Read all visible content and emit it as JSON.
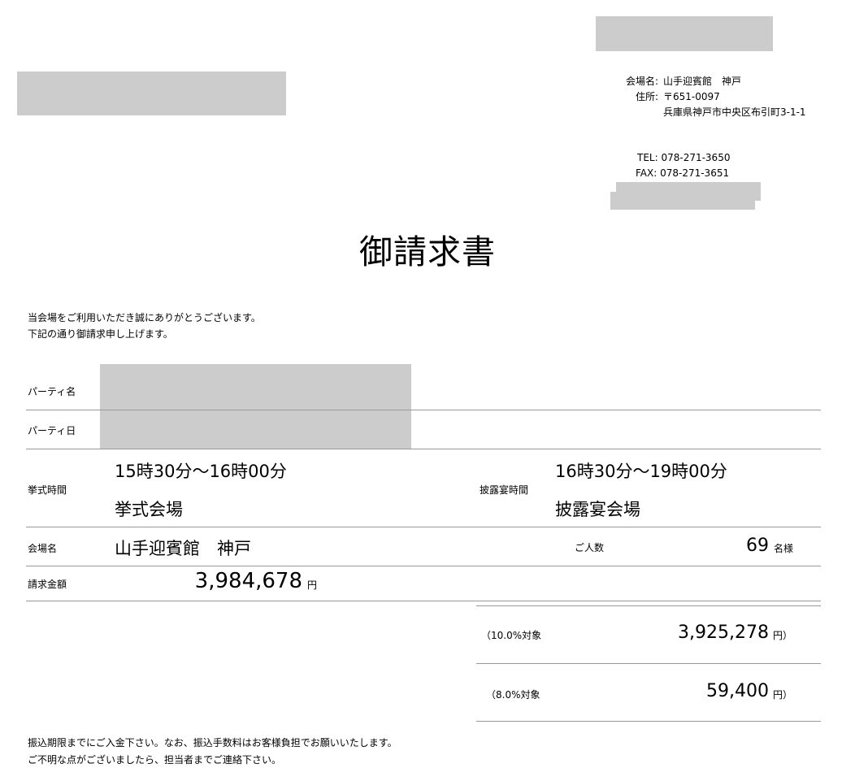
{
  "venue": {
    "name_label": "会場名:",
    "name": "山手迎賓館　神戸",
    "address_label": "住所:",
    "postal": "〒651-0097",
    "address": "兵庫県神戸市中央区布引町3-1-1",
    "tel": "TEL: 078-271-3650",
    "fax": "FAX: 078-271-3651"
  },
  "title": "御請求書",
  "greeting": {
    "line1": "当会場をご利用いただき誠にありがとうございます。",
    "line2": "下記の通り御請求申し上げます。"
  },
  "rows": {
    "party_name_label": "パーティ名",
    "party_date_label": "パーティ日",
    "ceremony_time_label": "挙式時間",
    "ceremony_time": "15時30分～16時00分",
    "ceremony_place": "挙式会場",
    "reception_time_label": "披露宴時間",
    "reception_time": "16時30分～19時00分",
    "reception_place": "披露宴会場",
    "venue_label": "会場名",
    "venue_name": "山手迎賓館　神戸",
    "guests_label": "ご人数",
    "guests_count": "69",
    "guests_unit": "名様",
    "amount_label": "請求金額",
    "amount": "3,984,678",
    "amount_unit": "円"
  },
  "tax": {
    "rate10_label": "（10.0%対象",
    "rate10_amount": "3,925,278",
    "rate10_unit": "円）",
    "rate8_label": "（8.0%対象",
    "rate8_amount": "59,400",
    "rate8_unit": "円）"
  },
  "footer": {
    "line1": "振込期限までにご入金下さい。なお、振込手数料はお客様負担でお願いいたします。",
    "line2": "ご不明な点がございましたら、担当者までご連絡下さい。"
  }
}
